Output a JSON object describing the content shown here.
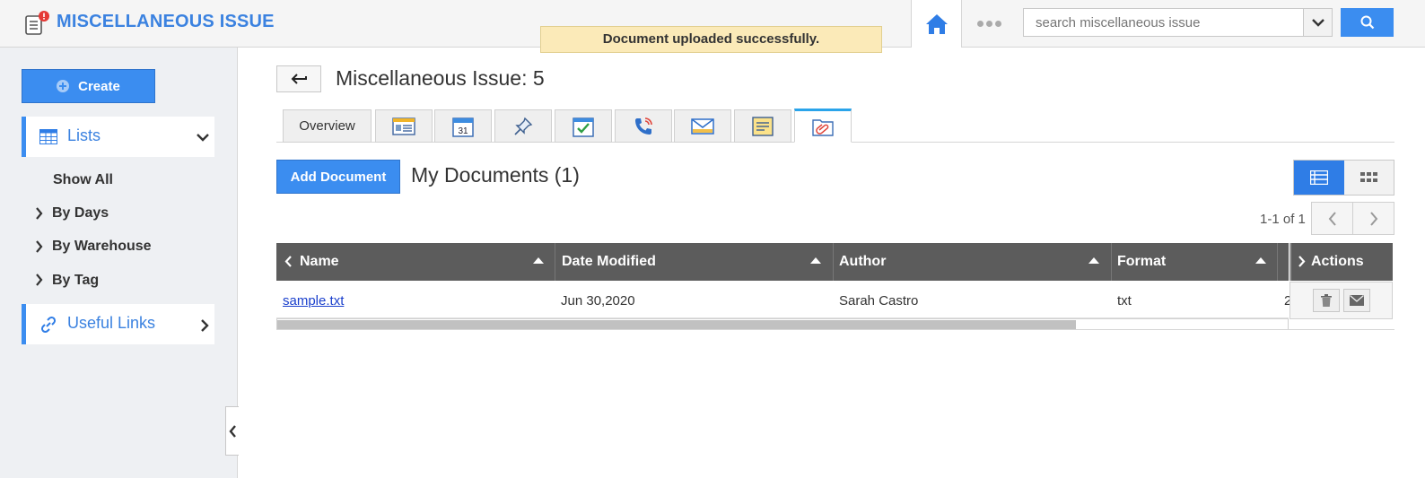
{
  "header": {
    "app_title": "MISCELLANEOUS ISSUE",
    "search_placeholder": "search miscellaneous issue",
    "accent_color": "#3b8df0"
  },
  "toast": {
    "message": "Document uploaded successfully."
  },
  "sidebar": {
    "create_label": "Create",
    "lists_label": "Lists",
    "show_all": "Show All",
    "sub_items": [
      "By Days",
      "By Warehouse",
      "By Tag"
    ],
    "useful_links_label": "Useful Links"
  },
  "main": {
    "title": "Miscellaneous Issue: 5",
    "tabs": [
      {
        "label": "Overview",
        "icon": "overview"
      },
      {
        "label": "",
        "icon": "details-card-icon"
      },
      {
        "label": "",
        "icon": "calendar-icon"
      },
      {
        "label": "",
        "icon": "pin-icon"
      },
      {
        "label": "",
        "icon": "task-check-icon"
      },
      {
        "label": "",
        "icon": "phone-call-icon"
      },
      {
        "label": "",
        "icon": "email-icon"
      },
      {
        "label": "",
        "icon": "notes-icon"
      },
      {
        "label": "",
        "icon": "document-clip-icon"
      }
    ],
    "active_tab": 8,
    "add_document_label": "Add Document",
    "section_title": "My Documents (1)",
    "pager_text": "1-1 of 1"
  },
  "table": {
    "columns": [
      "Name",
      "Date Modified",
      "Author",
      "Format",
      "Actions"
    ],
    "rows": [
      {
        "name": "sample.txt",
        "date_modified": "Jun 30,2020",
        "author": "Sarah Castro",
        "format": "txt",
        "size_partial": "2"
      }
    ]
  }
}
